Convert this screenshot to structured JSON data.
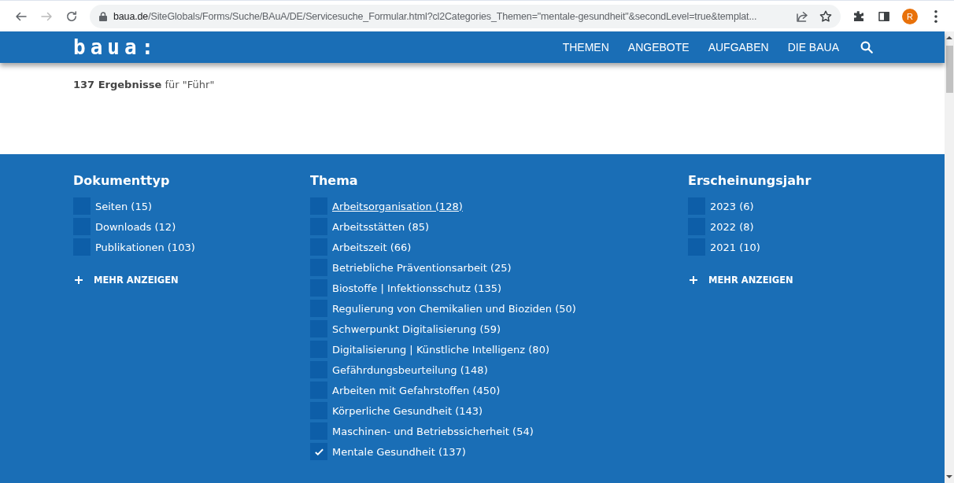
{
  "browser": {
    "back_disabled": false,
    "forward_disabled": true,
    "url": {
      "domain": "baua.de",
      "path": "/SiteGlobals/Forms/Suche/BAuA/DE/Servicesuche_Formular.html?cl2Categories_Themen=\"mentale-gesundheit\"&secondLevel=true&templat..."
    },
    "avatar": "R"
  },
  "header": {
    "logo": "baua:",
    "nav": [
      "THEMEN",
      "ANGEBOTE",
      "AUFGABEN",
      "DIE BAUA"
    ]
  },
  "results": "**137 Ergebnisse** für \"Führ\"",
  "filters": [
    {
      "title": "Dokumenttyp",
      "more": "MEHR ANZEIGEN",
      "options": [
        {
          "label": "Seiten (15)",
          "checked": false,
          "hovered": false
        },
        {
          "label": "Downloads (12)",
          "checked": false,
          "hovered": false
        },
        {
          "label": "Publikationen (103)",
          "checked": false,
          "hovered": false
        }
      ]
    },
    {
      "title": "Thema",
      "options": [
        {
          "label": "Arbeitsorganisation (128)",
          "checked": false,
          "hovered": true
        },
        {
          "label": "Arbeitsstätten (85)",
          "checked": false,
          "hovered": false
        },
        {
          "label": "Arbeitszeit (66)",
          "checked": false,
          "hovered": false
        },
        {
          "label": "Betriebliche Präventionsarbeit (25)",
          "checked": false,
          "hovered": false
        },
        {
          "label": "Biostoffe | Infektionsschutz (135)",
          "checked": false,
          "hovered": false
        },
        {
          "label": "Regulierung von Chemikalien und Bioziden (50)",
          "checked": false,
          "hovered": false
        },
        {
          "label": "Schwerpunkt Digitalisierung (59)",
          "checked": false,
          "hovered": false
        },
        {
          "label": "Digitalisierung | Künstliche Intelligenz (80)",
          "checked": false,
          "hovered": false
        },
        {
          "label": "Gefährdungsbeurteilung (148)",
          "checked": false,
          "hovered": false
        },
        {
          "label": "Arbeiten mit Gefahrstoffen (450)",
          "checked": false,
          "hovered": false
        },
        {
          "label": "Körperliche Gesundheit (143)",
          "checked": false,
          "hovered": false
        },
        {
          "label": "Maschinen- und Betriebssicherheit (54)",
          "checked": false,
          "hovered": false
        },
        {
          "label": "Mentale Gesundheit (137)",
          "checked": true,
          "hovered": false
        }
      ]
    },
    {
      "title": "Erscheinungsjahr",
      "more": "MEHR ANZEIGEN",
      "options": [
        {
          "label": "2023 (6)",
          "checked": false,
          "hovered": false
        },
        {
          "label": "2022 (8)",
          "checked": false,
          "hovered": false
        },
        {
          "label": "2021 (10)",
          "checked": false,
          "hovered": false
        }
      ]
    }
  ]
}
